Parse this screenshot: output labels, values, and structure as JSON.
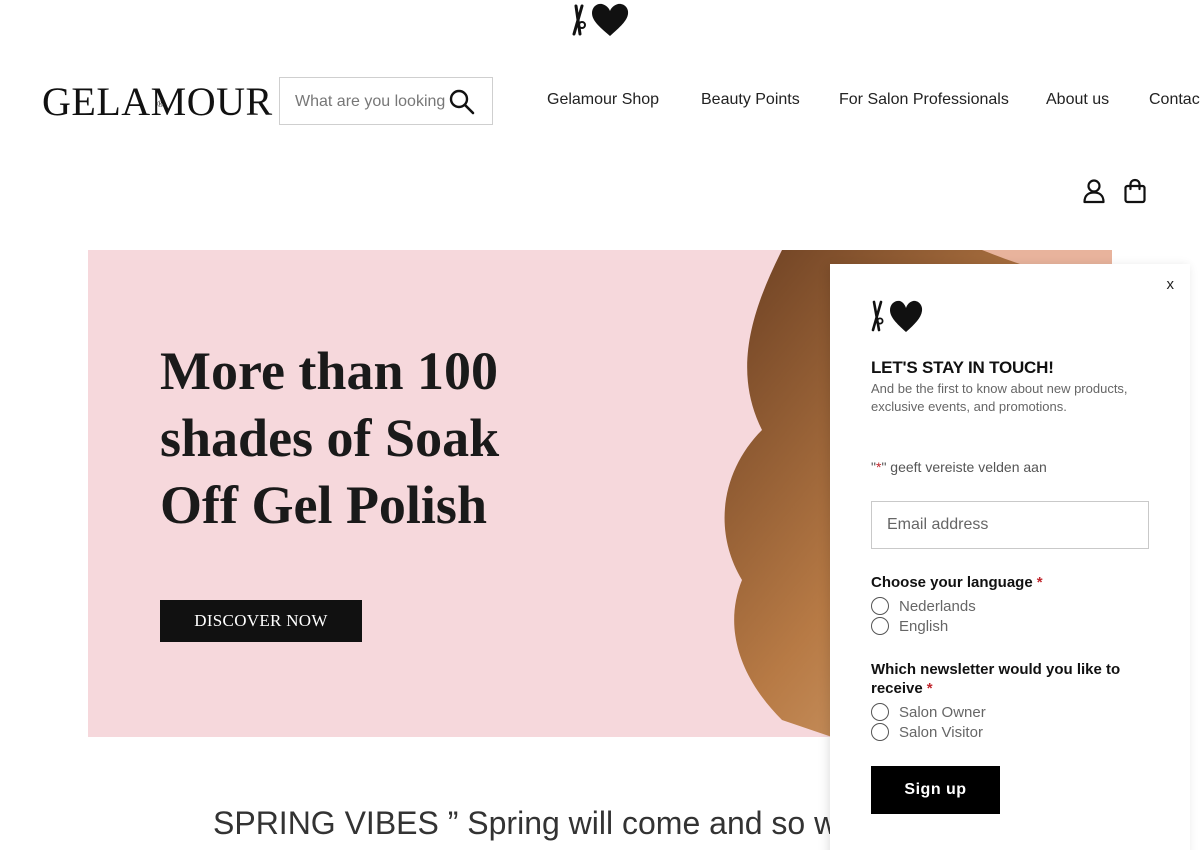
{
  "header": {
    "brand": "GELAMOUR",
    "brand_mark": "®",
    "search_placeholder": "What are you looking for?",
    "nav": [
      {
        "label": "Gelamour Shop"
      },
      {
        "label": "Beauty Points"
      },
      {
        "label": "For Salon Professionals"
      },
      {
        "label": "About us"
      },
      {
        "label": "Contact"
      }
    ]
  },
  "hero": {
    "title_lines": [
      "More than 100",
      "shades of Soak",
      "Off Gel Polish"
    ],
    "button_label": "DISCOVER NOW",
    "bg_color": "#f6d8dc"
  },
  "banner": {
    "text": "SPRING VIBES ” Spring will come and so will"
  },
  "popup": {
    "close_label": "x",
    "title": "LET'S STAY IN TOUCH!",
    "subtitle": "And be the first to know about new products, exclusive events, and promotions.",
    "required_note_quote_open": "\"",
    "required_note_star": "*",
    "required_note_rest": "\" geeft vereiste velden aan",
    "email_placeholder": "Email address",
    "language_question": "Choose your language",
    "language_options": [
      "Nederlands",
      "English"
    ],
    "newsletter_question": "Which newsletter would you like to receive",
    "newsletter_options": [
      "Salon Owner",
      "Salon Visitor"
    ],
    "required_star": "*",
    "signup_label": "Sign up"
  },
  "icons": {
    "top_logo": "scissors-heart-logo-icon",
    "search": "search-icon",
    "account": "user-icon",
    "cart": "shopping-bag-icon"
  },
  "colors": {
    "accent": "#000000",
    "required": "#c0262d",
    "hero_bg": "#f6d8dc"
  }
}
